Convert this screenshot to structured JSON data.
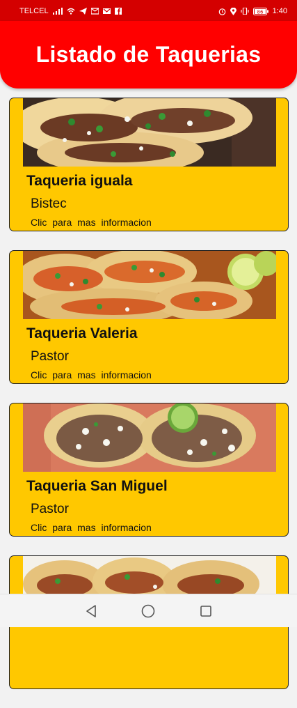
{
  "status_bar": {
    "carrier": "TELCEL",
    "battery": "86",
    "time": "1:40"
  },
  "app_bar": {
    "title": "Listado de Taquerias"
  },
  "taquerias": [
    {
      "name": "Taqueria iguala",
      "type": "Bistec",
      "more": "Clic para mas informacion",
      "image": "bistec-tacos-photo"
    },
    {
      "name": "Taqueria Valeria",
      "type": "Pastor",
      "more": "Clic para mas informacion",
      "image": "pastor-tacos-photo"
    },
    {
      "name": "Taqueria San Miguel",
      "type": "Pastor",
      "more": "Clic para mas informacion",
      "image": "tacos-lime-photo"
    },
    {
      "name": "",
      "type": "",
      "more": "",
      "image": "tacos-photo"
    }
  ],
  "nav": {
    "back": "back-icon",
    "home": "home-icon",
    "recents": "recents-icon"
  },
  "colors": {
    "status_bar": "#d40000",
    "app_bar": "#ff0000",
    "card": "#ffc800"
  }
}
